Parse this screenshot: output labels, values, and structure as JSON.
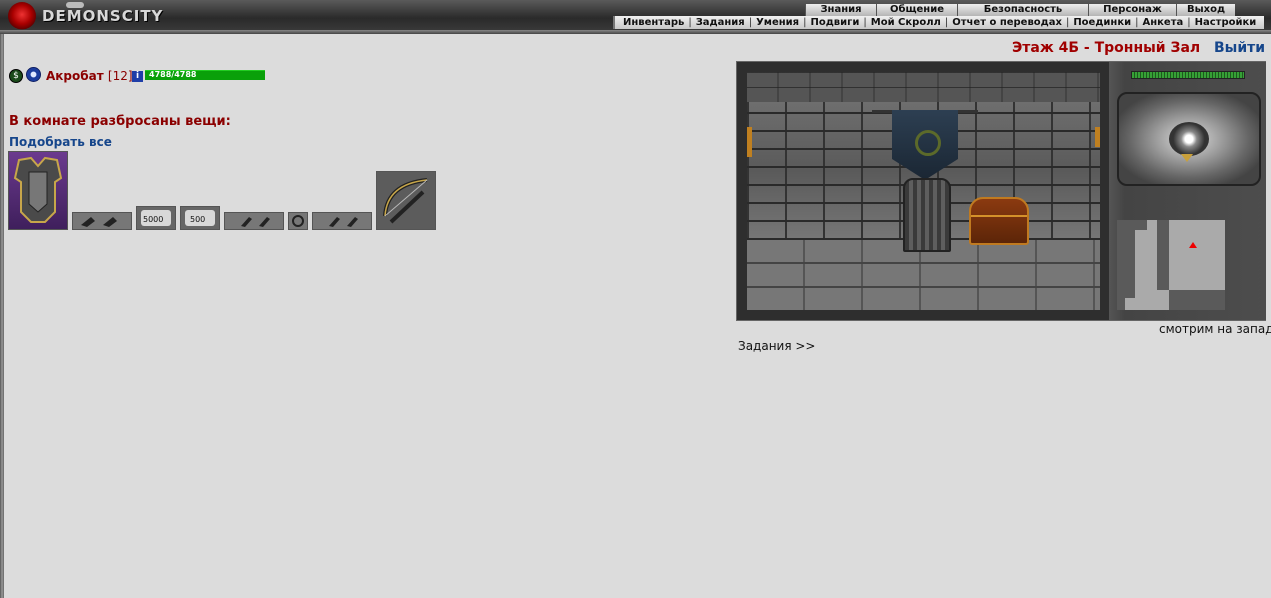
{
  "app": {
    "name": "DEMONSCITY"
  },
  "menu_main": [
    "Знания",
    "Общение",
    "Безопасность",
    "Персонаж",
    "Выход"
  ],
  "menu_sub": [
    "Инвентарь",
    "Задания",
    "Умения",
    "Подвиги",
    "Мой Скролл",
    "Отчет о переводах",
    "Поединки",
    "Анкета",
    "Настройки"
  ],
  "player": {
    "name": "Акробат",
    "level": "[12]",
    "hp_text": "4788/4788",
    "hp_fraction": 1.0,
    "align_icon": "alignment-icon",
    "clan_icon": "clan-icon",
    "info_icon": "info-icon",
    "info_label": "i"
  },
  "room": {
    "title": "Этаж 4Б - Тронный Зал",
    "exit_label": "Выйти",
    "view_direction": "смотрим на запад"
  },
  "loot": {
    "title": "В комнате разбросаны вещи:",
    "pickup_all": "Подобрать все",
    "items": [
      {
        "icon": "armor-icon"
      },
      {
        "icon": "bracers-icon"
      },
      {
        "icon": "scroll-icon",
        "label": "5000"
      },
      {
        "icon": "scroll-icon",
        "label": "500"
      },
      {
        "icon": "bracers-icon"
      },
      {
        "icon": "ring-icon"
      },
      {
        "icon": "bracers-icon"
      },
      {
        "icon": "crossbow-icon"
      }
    ]
  },
  "quests_link": "Задания >>",
  "colors": {
    "accent_red": "#a00000",
    "link_blue": "#16468b",
    "hp_green": "#0aa00a",
    "background": "#dcdcdc"
  }
}
